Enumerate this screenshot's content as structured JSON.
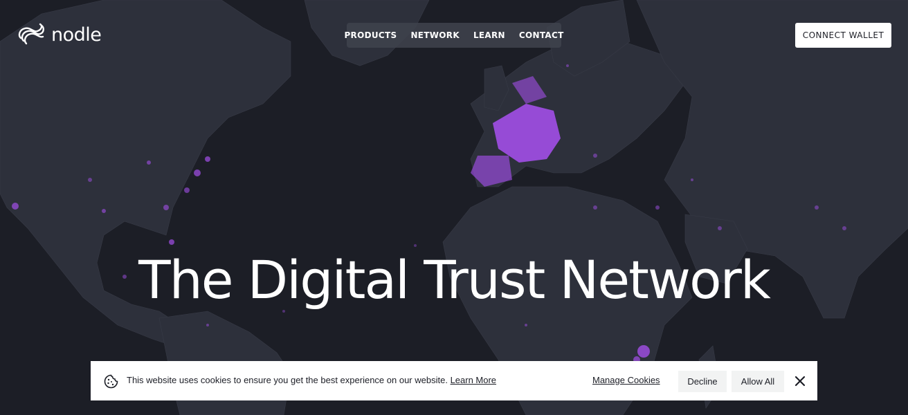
{
  "brand": {
    "name": "nodle"
  },
  "nav": {
    "items": [
      {
        "label": "PRODUCTS"
      },
      {
        "label": "NETWORK"
      },
      {
        "label": "LEARN"
      },
      {
        "label": "CONTACT"
      }
    ]
  },
  "header": {
    "connect_label": "CONNECT WALLET"
  },
  "hero": {
    "title": "The Digital Trust Network"
  },
  "cookie": {
    "message": "This website uses cookies to ensure you get the best experience on our website.",
    "learn_more": "Learn More",
    "manage": "Manage Cookies",
    "decline": "Decline",
    "allow": "Allow All"
  },
  "icons": {
    "logo": "nodle-logo-icon",
    "cookie": "cookie-icon",
    "close": "close-icon"
  },
  "colors": {
    "background": "#1c1e26",
    "land": "#2d303b",
    "accent": "#a24fe8",
    "white": "#ffffff"
  }
}
